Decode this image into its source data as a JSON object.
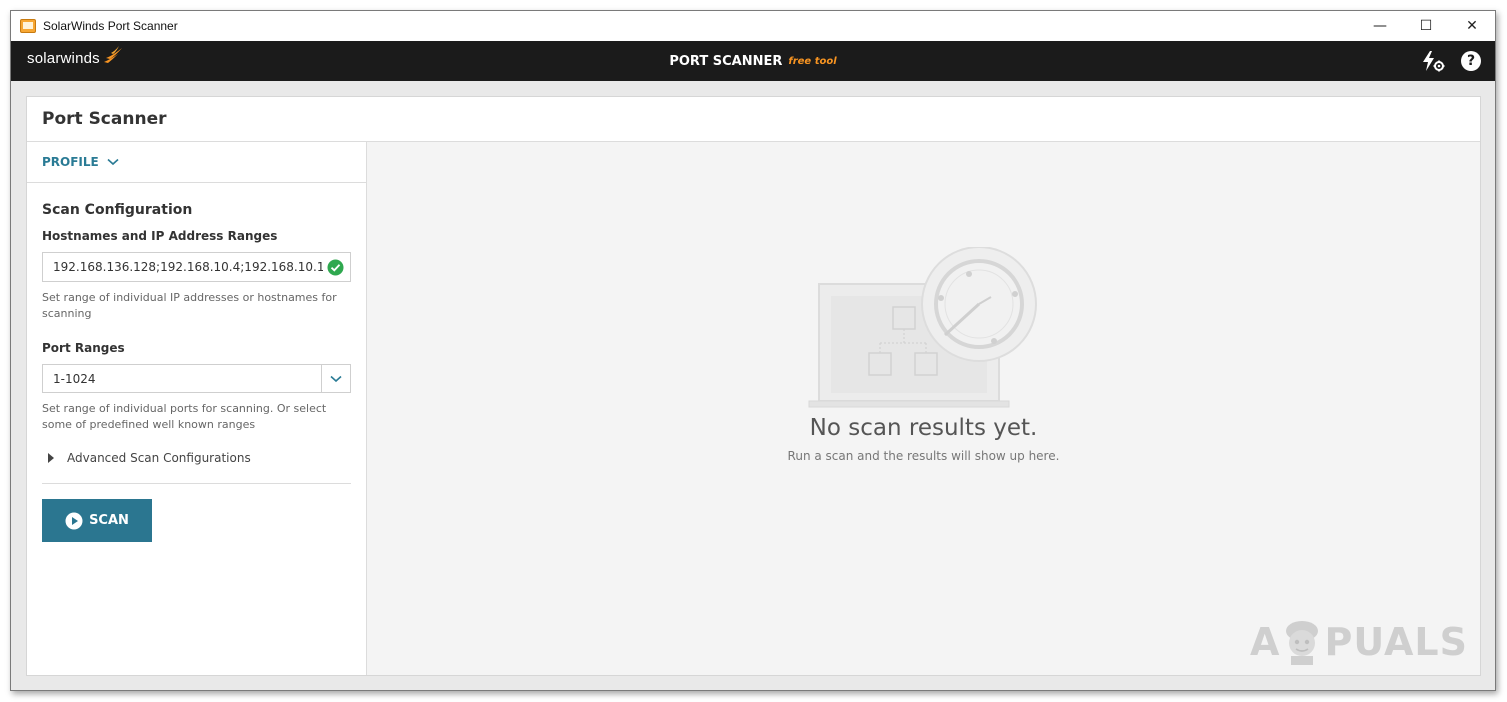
{
  "window": {
    "title": "SolarWinds Port Scanner",
    "controls": {
      "minimize": "—",
      "maximize": "☐",
      "close": "✕"
    }
  },
  "appbar": {
    "brand": "solarwinds",
    "title": "PORT SCANNER",
    "subtitle": "free tool",
    "icons": [
      "lightning-settings-icon",
      "help-icon"
    ],
    "help_glyph": "?"
  },
  "card": {
    "title": "Port Scanner"
  },
  "left_panel": {
    "profile_label": "PROFILE",
    "section_title": "Scan Configuration",
    "hosts": {
      "label": "Hostnames and IP Address Ranges",
      "value": "192.168.136.128;192.168.10.4;192.168.10.1",
      "hint": "Set range of individual IP addresses or hostnames for scanning"
    },
    "ports": {
      "label": "Port Ranges",
      "value": "1-1024",
      "hint": "Set range of individual ports for scanning. Or select some of predefined well known ranges"
    },
    "advanced_label": "Advanced Scan Configurations",
    "scan_label": "SCAN"
  },
  "results": {
    "empty_title": "No scan results yet.",
    "empty_subtitle": "Run a scan and the results will show up here."
  },
  "watermark": {
    "left": "A",
    "right": "PUALS"
  },
  "colors": {
    "accent": "#2b7690",
    "brand_orange": "#f79422",
    "success": "#2fa84f",
    "appbar": "#1b1b1b"
  }
}
